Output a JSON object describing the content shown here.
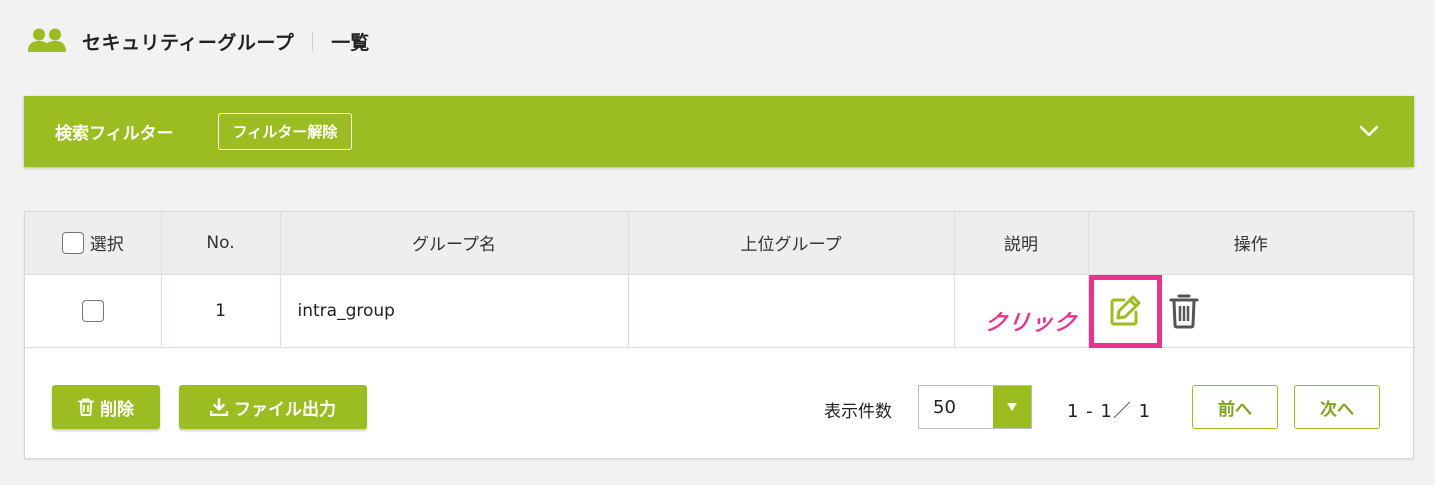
{
  "header": {
    "title": "セキュリティーグループ",
    "subtitle": "一覧",
    "icon": "users-icon"
  },
  "filter": {
    "label": "検索フィルター",
    "reset_label": "フィルター解除",
    "toggle_icon": "chevron-down-icon"
  },
  "colors": {
    "accent": "#9bbd21",
    "highlight": "#e8348d"
  },
  "table": {
    "columns": [
      "選択",
      "No.",
      "グループ名",
      "上位グループ",
      "説明",
      "操作"
    ],
    "rows": [
      {
        "no": "1",
        "name": "intra_group",
        "parent": "",
        "description": ""
      }
    ]
  },
  "annotation": {
    "text": "クリック"
  },
  "footer": {
    "delete_label": "削除",
    "export_label": "ファイル出力",
    "per_page_label": "表示件数",
    "per_page_value": "50",
    "range": "1 - 1／ 1",
    "prev_label": "前へ",
    "next_label": "次へ"
  }
}
